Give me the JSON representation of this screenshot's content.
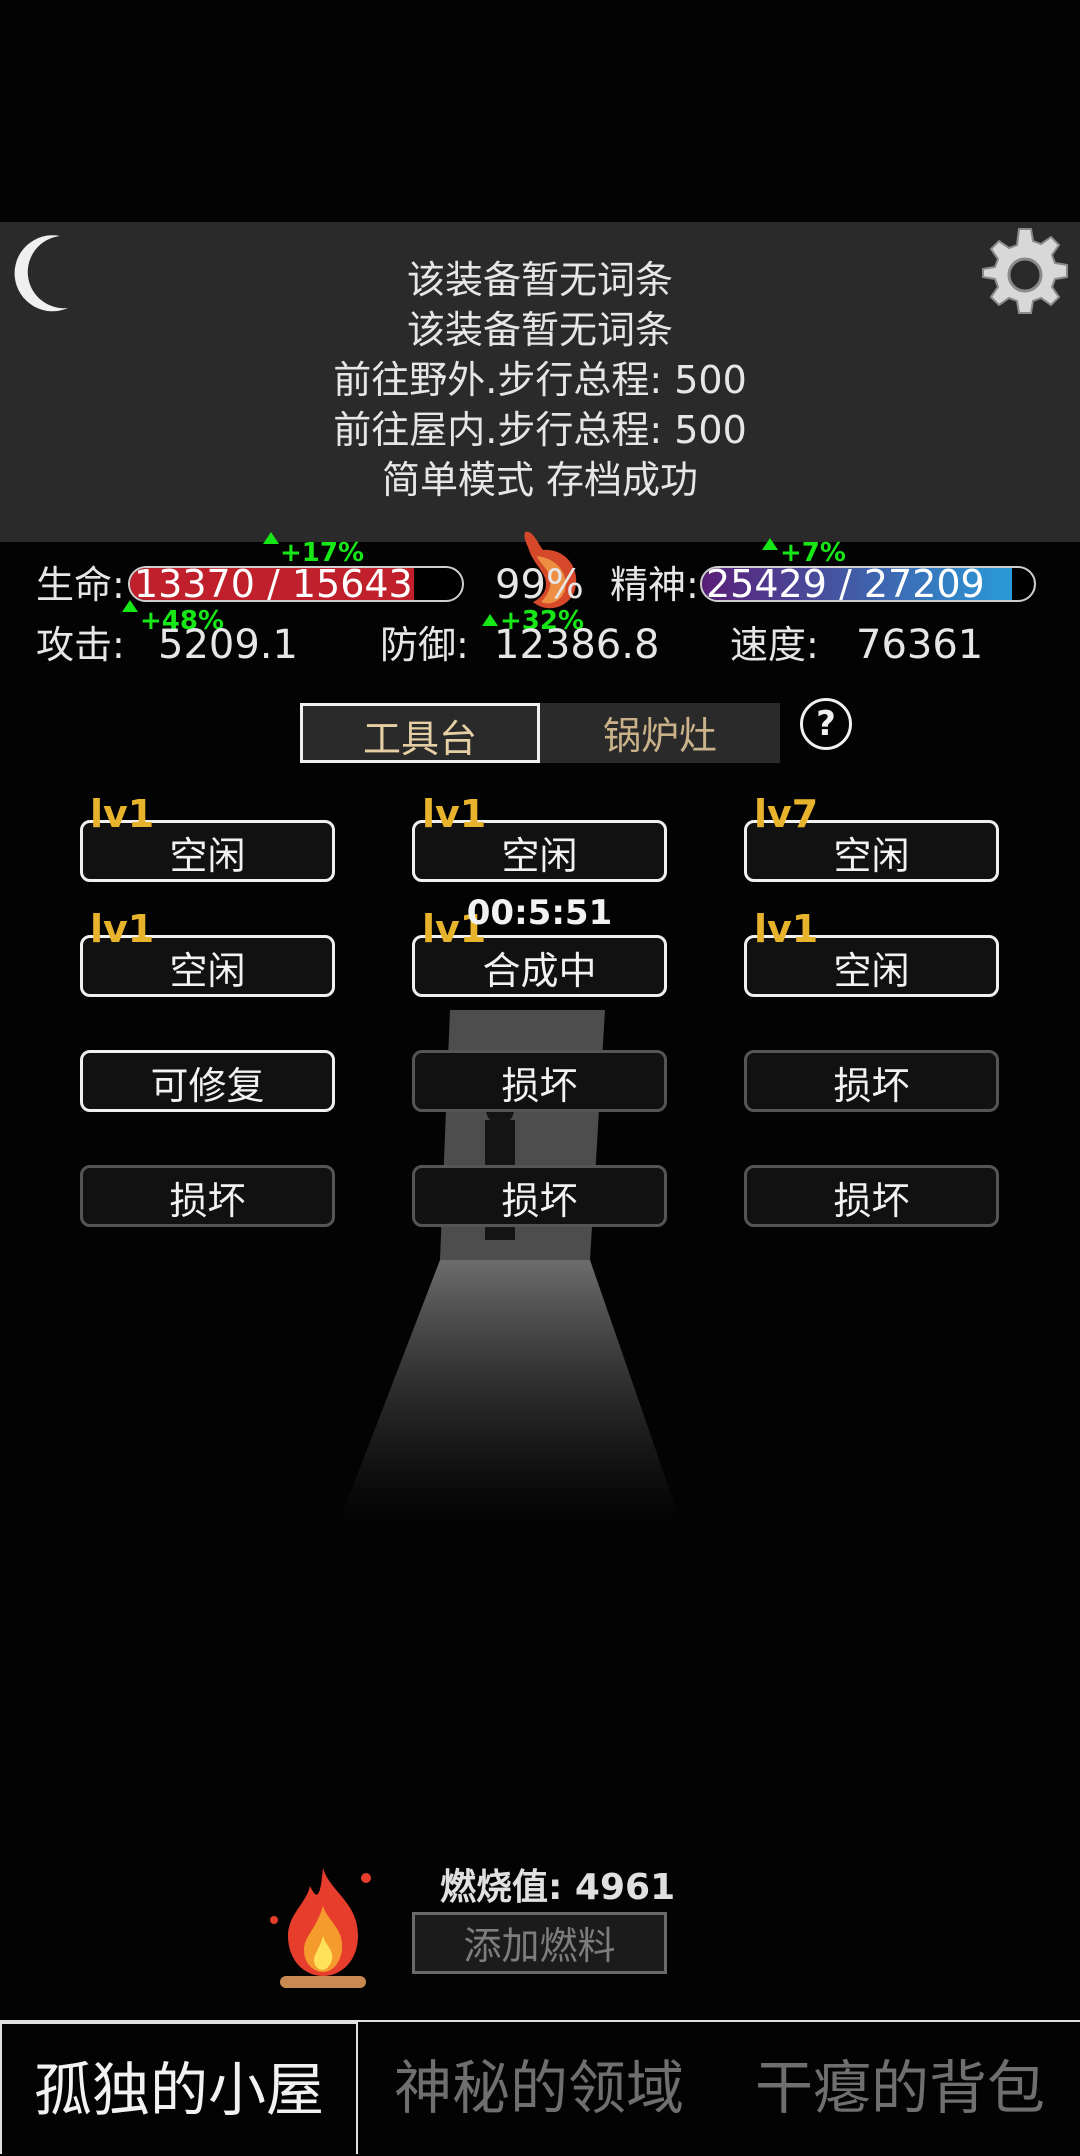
{
  "log": {
    "lines": [
      "该装备暂无词条",
      "该装备暂无词条",
      "前往野外.步行总程: 500",
      "前往屋内.步行总程: 500",
      "简单模式 存档成功"
    ]
  },
  "stats": {
    "life_label": "生命:",
    "life_value": "13370 / 15643",
    "life_fraction": 0.855,
    "life_bonus": "+17%",
    "satiety": "99%",
    "spirit_label": "精神:",
    "spirit_value": "25429 / 27209",
    "spirit_fraction": 0.935,
    "spirit_bonus": "+7%",
    "attack_label": "攻击:",
    "attack_value": "5209.1",
    "attack_bonus": "+48%",
    "defense_label": "防御:",
    "defense_value": "12386.8",
    "defense_bonus": "+32%",
    "speed_label": "速度:",
    "speed_value": "76361"
  },
  "tabs": [
    "工具台",
    "锅炉灶"
  ],
  "help_label": "?",
  "slots": [
    {
      "level": "lv1",
      "status": "空闲"
    },
    {
      "level": "lv1",
      "status": "空闲"
    },
    {
      "level": "lv7",
      "status": "空闲"
    },
    {
      "level": "lv1",
      "status": "空闲"
    },
    {
      "level": "lv1",
      "status": "合成中",
      "timer": "00:5:51"
    },
    {
      "level": "lv1",
      "status": "空闲"
    },
    {
      "level": "",
      "status": "可修复"
    },
    {
      "level": "",
      "status": "损坏"
    },
    {
      "level": "",
      "status": "损坏"
    },
    {
      "level": "",
      "status": "损坏"
    },
    {
      "level": "",
      "status": "损坏"
    },
    {
      "level": "",
      "status": "损坏"
    }
  ],
  "fire": {
    "burn_label": "燃烧值: 4961",
    "add_fuel": "添加燃料"
  },
  "nav": [
    "孤独的小屋",
    "神秘的领域",
    "干瘪的背包"
  ],
  "colors": {
    "life": "#c0202c",
    "spirit": "#2a9ad8",
    "level": "#e8b32c",
    "bonus": "#17e617"
  }
}
